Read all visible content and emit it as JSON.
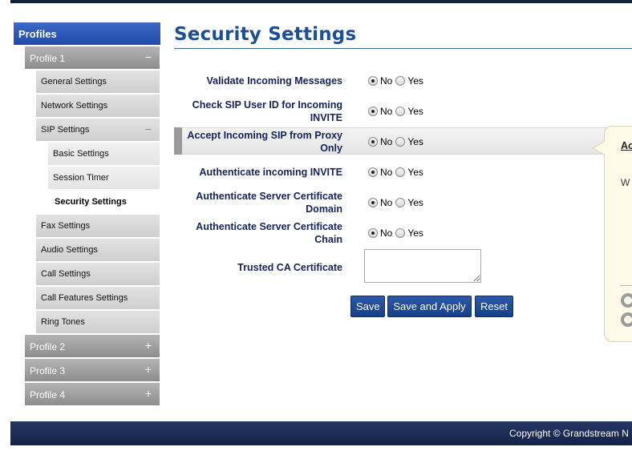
{
  "sidebar": {
    "header": "Profiles",
    "profile1": {
      "label": "Profile 1",
      "toggle": "−"
    },
    "items": [
      "General Settings",
      "Network Settings",
      "SIP Settings",
      "Fax Settings",
      "Audio Settings",
      "Call Settings",
      "Call Features Settings",
      "Ring Tones"
    ],
    "sip_toggle": "−",
    "sip_items": [
      "Basic Settings",
      "Session Timer",
      "Security Settings"
    ],
    "profiles": [
      {
        "label": "Profile 2",
        "toggle": "+"
      },
      {
        "label": "Profile 3",
        "toggle": "+"
      },
      {
        "label": "Profile 4",
        "toggle": "+"
      }
    ]
  },
  "main": {
    "title": "Security Settings",
    "fields": [
      {
        "label": "Validate Incoming Messages",
        "value": "No"
      },
      {
        "label": "Check SIP User ID for Incoming INVITE",
        "value": "No"
      },
      {
        "label": "Accept Incoming SIP from Proxy Only",
        "value": "No"
      },
      {
        "label": "Authenticate incoming INVITE",
        "value": "No"
      },
      {
        "label": "Authenticate Server Certificate Domain",
        "value": "No"
      },
      {
        "label": "Authenticate Server Certificate Chain",
        "value": "No"
      }
    ],
    "radio_options": [
      "No",
      "Yes"
    ],
    "trusted_ca": {
      "label": "Trusted CA Certificate",
      "value": ""
    },
    "buttons": {
      "save": "Save",
      "save_apply": "Save and Apply",
      "reset": "Reset"
    }
  },
  "help": {
    "title": "Ac Pr",
    "body": "W ac th be th ac re als"
  },
  "footer": {
    "copyright": "Copyright © Grandstream N"
  }
}
